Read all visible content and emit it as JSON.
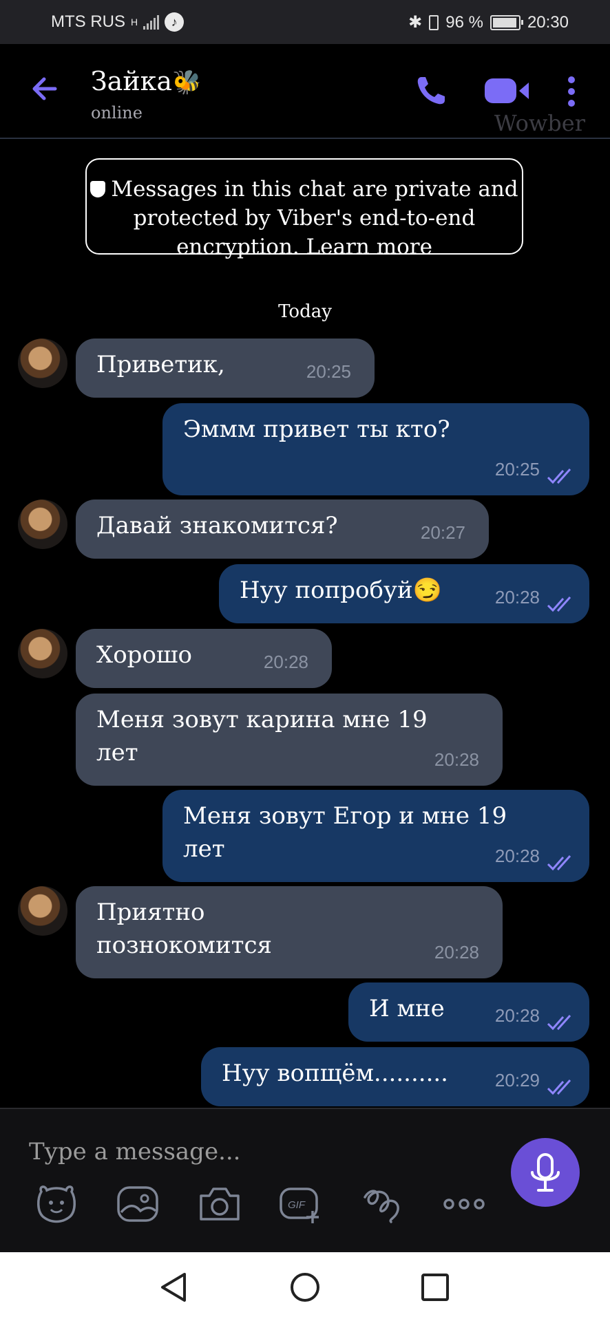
{
  "status_bar": {
    "carrier": "MTS RUS",
    "network": "H",
    "battery_percent": "96 %",
    "time": "20:30"
  },
  "header": {
    "title": "Зайка",
    "status": "online",
    "watermark": "Wowber"
  },
  "chat": {
    "encryption_notice": "Messages in this chat are private and protected by Viber's end-to-end encryption. Learn more",
    "day_label": "Today",
    "messages": [
      {
        "dir": "in",
        "text": "Приветик,",
        "time": "20:25"
      },
      {
        "dir": "out",
        "text": "Эммм привет ты кто?",
        "time": "20:25"
      },
      {
        "dir": "in",
        "text": "Давай знакомится?",
        "time": "20:27"
      },
      {
        "dir": "out",
        "text": "Нуу попробуй😏",
        "time": "20:28"
      },
      {
        "dir": "in",
        "text": "Хорошо",
        "time": "20:28"
      },
      {
        "dir": "in",
        "text": "Меня зовут карина мне 19 лет",
        "time": "20:28"
      },
      {
        "dir": "out",
        "text": "Меня зовут Егор и мне 19 лет",
        "time": "20:28"
      },
      {
        "dir": "in",
        "text": "Приятно познокомится",
        "time": "20:28"
      },
      {
        "dir": "out",
        "text": "И мне",
        "time": "20:28"
      },
      {
        "dir": "out",
        "text": "Нуу вопщём..........",
        "time": "20:29"
      }
    ]
  },
  "composer": {
    "placeholder": "Type a message..."
  },
  "colors": {
    "accent": "#6a4fd6",
    "incoming_bubble": "#3f4757",
    "outgoing_bubble": "#173864",
    "tick": "#8f86ff"
  }
}
